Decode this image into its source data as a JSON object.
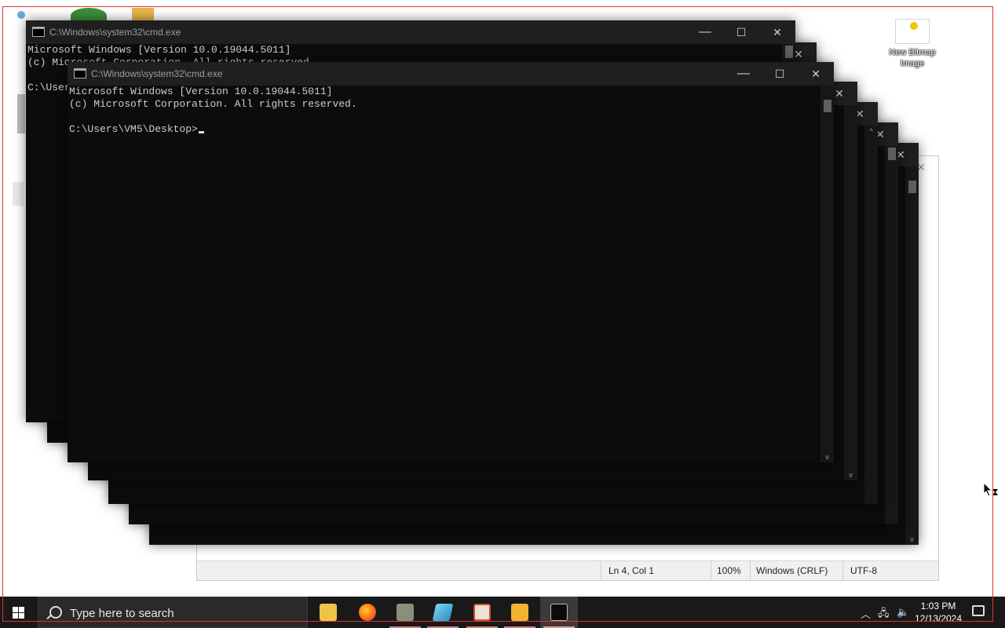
{
  "desktop": {
    "new_bitmap_label": "New Bitmap Image"
  },
  "notepad": {
    "status_position": "Ln 4, Col 1",
    "status_zoom": "100%",
    "status_eol": "Windows (CRLF)",
    "status_encoding": "UTF-8"
  },
  "cmd_back": {
    "title": "C:\\Windows\\system32\\cmd.exe",
    "line1": "Microsoft Windows [Version 10.0.19044.5011]",
    "line2": "(c) Microsoft Corporation. All rights reserved.",
    "line4": "C:\\Users\\VM5\\Desktop>"
  },
  "cmd_front": {
    "title": "C:\\Windows\\system32\\cmd.exe",
    "line1": "Microsoft Windows [Version 10.0.19044.5011]",
    "line2": "(c) Microsoft Corporation. All rights reserved.",
    "line4": "C:\\Users\\VM5\\Desktop>"
  },
  "window_controls": {
    "minimize": "—",
    "maximize": "☐",
    "close": "✕"
  },
  "taskbar": {
    "search_placeholder": "Type here to search",
    "apps": [
      "file-explorer",
      "firefox",
      "app-3",
      "app-4",
      "app-5",
      "media-player",
      "command-prompt"
    ],
    "clock_time": "1:03 PM",
    "clock_date": "12/13/2024"
  },
  "colors": {
    "console_bg": "#0c0c0c",
    "console_text": "#cccccc",
    "taskbar_bg": "#191919",
    "border_red": "#dd3333"
  }
}
